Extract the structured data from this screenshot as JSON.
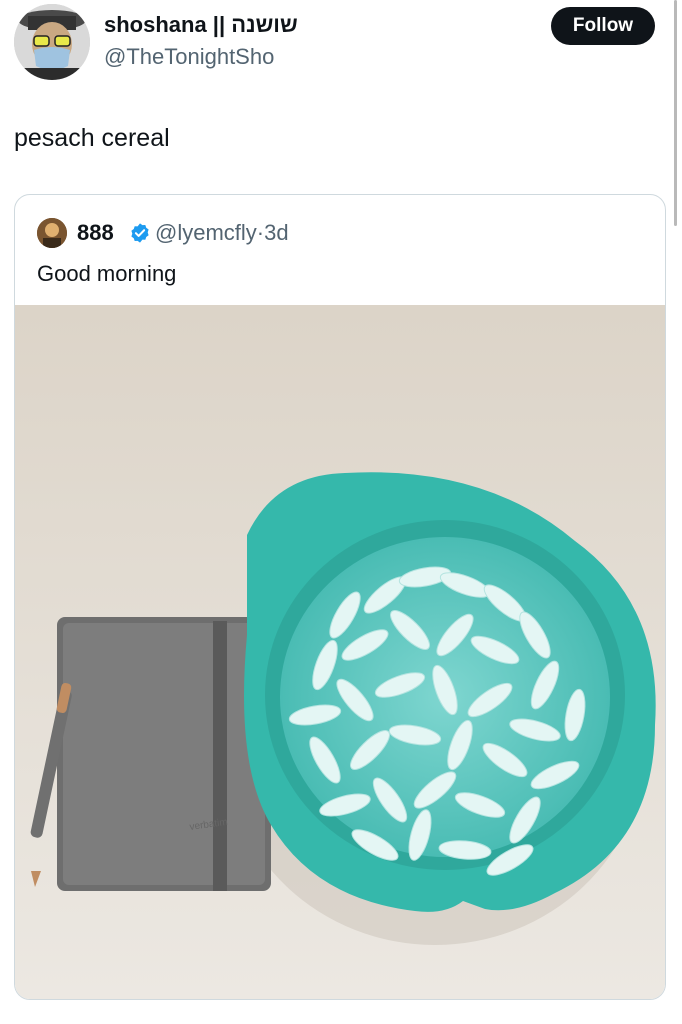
{
  "tweet": {
    "author_name": "shoshana || שושנה",
    "author_handle": "@TheTonightSho",
    "follow_label": "Follow",
    "text": "pesach cereal"
  },
  "quoted_tweet": {
    "author_name": "888",
    "author_handle": "@lyemcfly",
    "separator": "·",
    "age": "3d",
    "text": "Good morning",
    "verified_badge_color": "#1d9bf0"
  },
  "icons": [
    "avatar",
    "verified-badge-icon"
  ],
  "colors": {
    "follow_button_bg": "#0f1419",
    "text_secondary": "#536471",
    "card_border": "#cfd9de",
    "bowl_teal": "#3cc6b8"
  }
}
